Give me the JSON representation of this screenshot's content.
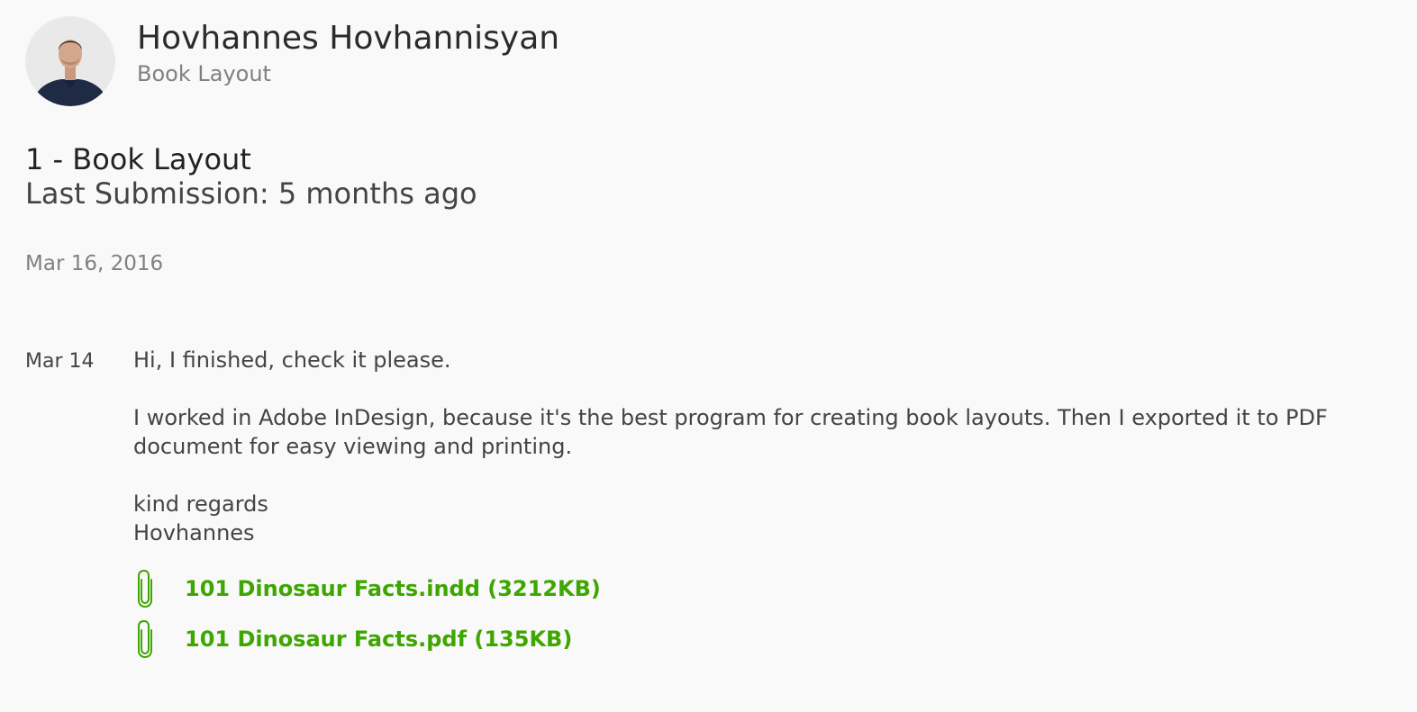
{
  "header": {
    "name": "Hovhannes Hovhannisyan",
    "project": "Book Layout"
  },
  "submission": {
    "title": "1 - Book Layout",
    "last_submission": "Last Submission: 5 months ago"
  },
  "date_heading": "Mar 16, 2016",
  "message": {
    "date": "Mar 14",
    "greeting": "Hi, I finished, check it please.",
    "body": "I worked in Adobe InDesign, because it's the best program for creating book layouts. Then I exported it to PDF document for easy viewing and printing.",
    "closing": "kind regards",
    "signature": "Hovhannes"
  },
  "attachments": [
    {
      "label": "101 Dinosaur Facts.indd (3212KB)",
      "icon": "paperclip-icon"
    },
    {
      "label": "101 Dinosaur Facts.pdf (135KB)",
      "icon": "paperclip-icon"
    }
  ],
  "colors": {
    "background": "#f9f9f9",
    "attachment_link": "#3ea600",
    "muted_text": "#808080"
  }
}
